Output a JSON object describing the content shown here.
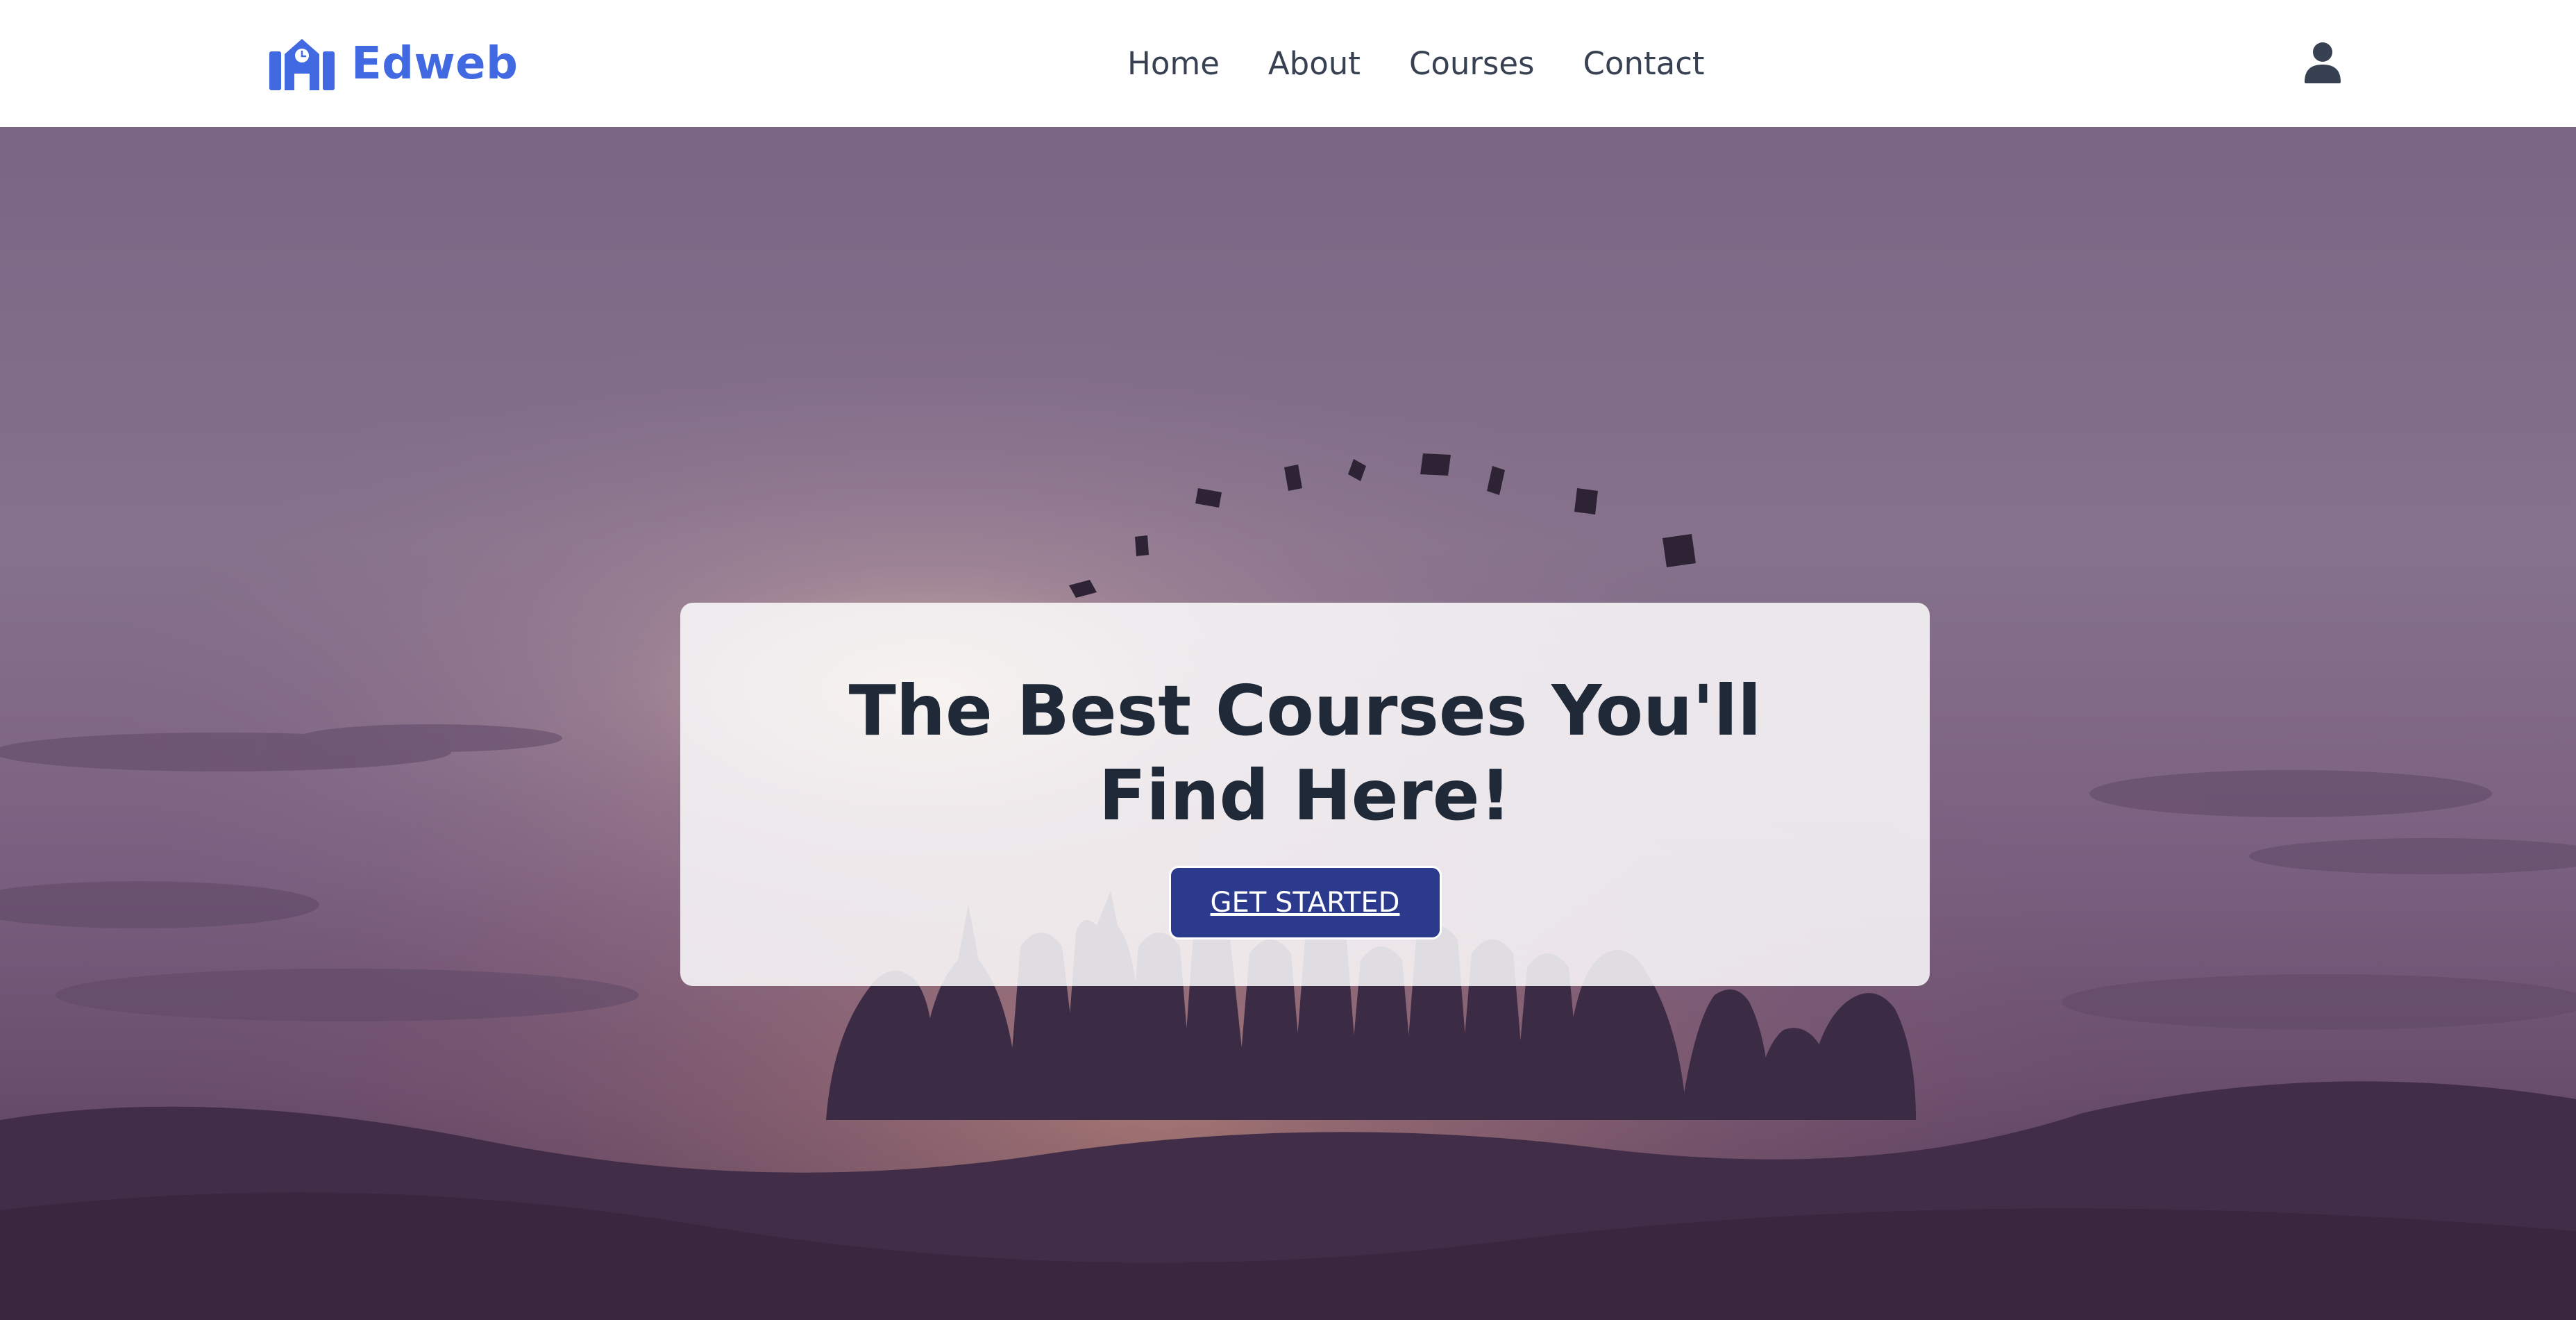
{
  "brand": {
    "name": "Edweb",
    "color": "#4169e1"
  },
  "nav": {
    "items": [
      {
        "label": "Home"
      },
      {
        "label": "About"
      },
      {
        "label": "Courses"
      },
      {
        "label": "Contact"
      }
    ]
  },
  "header": {
    "user_icon": "user-icon"
  },
  "hero": {
    "title": "The Best Courses You'll Find Here!",
    "cta_label": "GET STARTED",
    "cta_color": "#2b3a8c",
    "background": "graduates-silhouette-sunset-image"
  }
}
